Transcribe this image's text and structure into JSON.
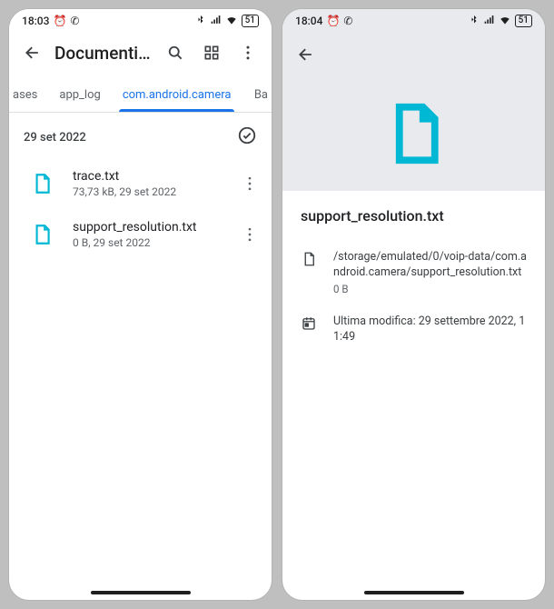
{
  "left": {
    "status": {
      "time": "18:03",
      "battery": "51"
    },
    "appbar": {
      "title": "Documenti e altr…"
    },
    "tabs": {
      "partial_left": "ases",
      "items": [
        "app_log",
        "com.android.camera"
      ],
      "active_index": 1,
      "partial_right": "Ba"
    },
    "section_date": "29 set 2022",
    "files": [
      {
        "name": "trace.txt",
        "meta": "73,73 kB, 29 set 2022"
      },
      {
        "name": "support_resolution.txt",
        "meta": "0 B, 29 set 2022"
      }
    ]
  },
  "right": {
    "status": {
      "time": "18:04",
      "battery": "51"
    },
    "title": "support_resolution.txt",
    "path": "/storage/emulated/0/voip-data/com.android.camera/support_resolution.txt",
    "size": "0 B",
    "modified": "Ultima modifica: 29 settembre 2022, 11:49"
  }
}
